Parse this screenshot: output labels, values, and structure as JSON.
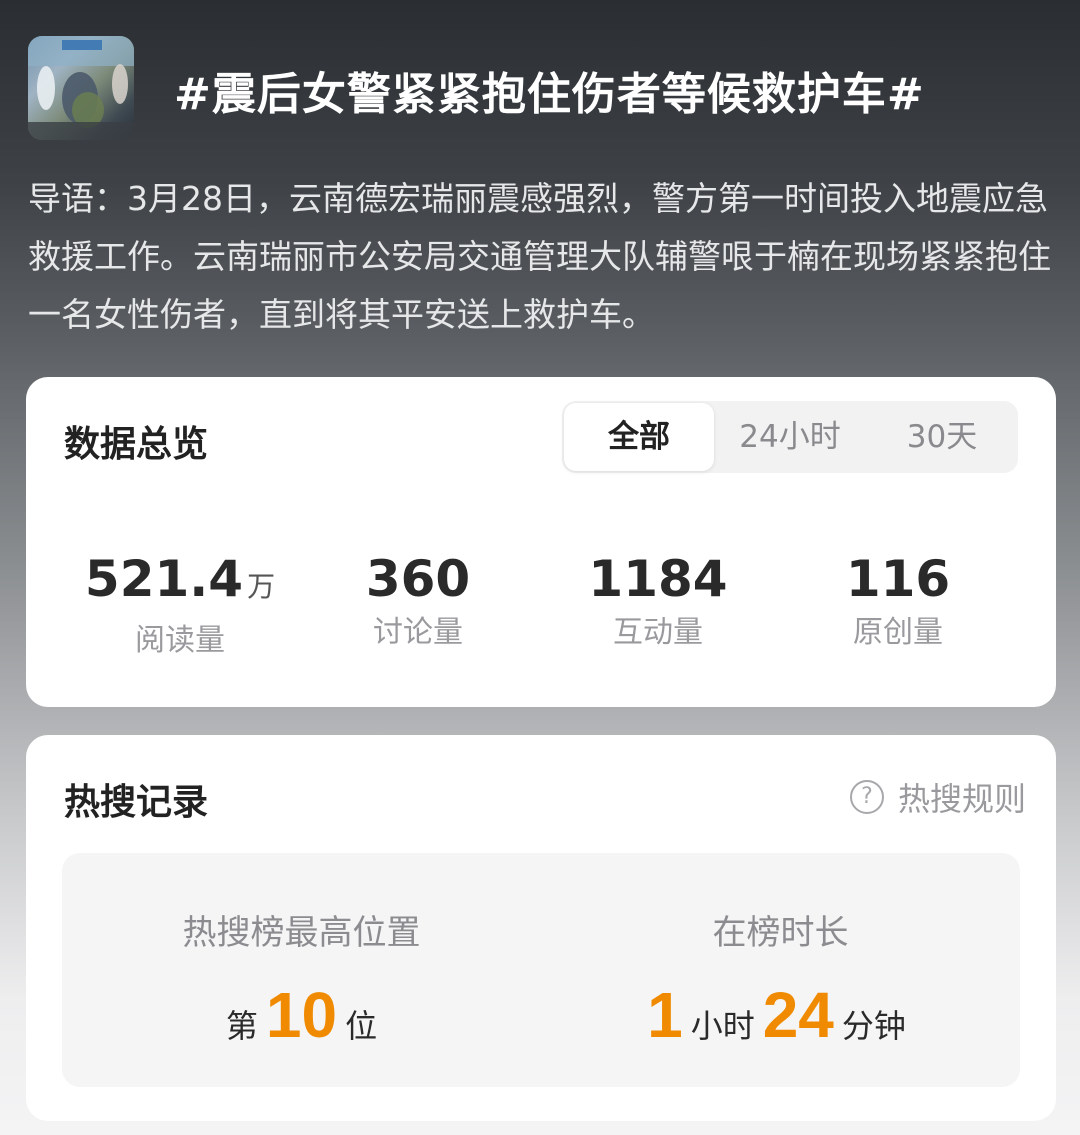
{
  "topic": {
    "title": "#震后女警紧紧抱住伤者等候救护车#",
    "intro": "导语：3月28日，云南德宏瑞丽震感强烈，警方第一时间投入地震应急救援工作。云南瑞丽市公安局交通管理大队辅警哏于楠在现场紧紧抱住一名女性伤者，直到将其平安送上救护车。"
  },
  "data_overview": {
    "title": "数据总览",
    "tabs": [
      {
        "label": "全部",
        "active": true
      },
      {
        "label": "24小时",
        "active": false
      },
      {
        "label": "30天",
        "active": false
      }
    ],
    "stats": [
      {
        "value": "521.4",
        "unit": "万",
        "label": "阅读量"
      },
      {
        "value": "360",
        "unit": "",
        "label": "讨论量"
      },
      {
        "value": "1184",
        "unit": "",
        "label": "互动量"
      },
      {
        "value": "116",
        "unit": "",
        "label": "原创量"
      }
    ]
  },
  "hot_search": {
    "title": "热搜记录",
    "rules_label": "热搜规则",
    "rules_icon": "question-circle-icon",
    "highest_position": {
      "label": "热搜榜最高位置",
      "prefix": "第",
      "value": "10",
      "suffix": "位"
    },
    "duration": {
      "label": "在榜时长",
      "hours": "1",
      "hours_unit": "小时",
      "minutes": "24",
      "minutes_unit": "分钟"
    }
  },
  "colors": {
    "accent": "#f08a00",
    "card_bg": "#ffffff",
    "muted_text": "#9a9a9e"
  }
}
